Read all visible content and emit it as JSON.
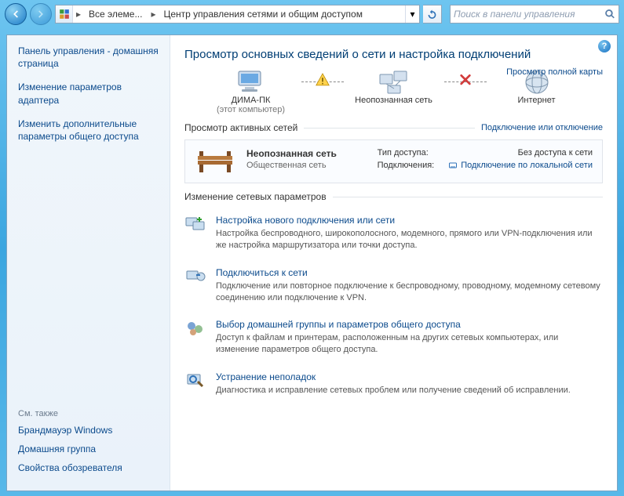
{
  "nav": {
    "crumb1": "Все элеме...",
    "crumb2": "Центр управления сетями и общим доступом",
    "search_placeholder": "Поиск в панели управления"
  },
  "sidebar": {
    "home": "Панель управления - домашняя страница",
    "items": [
      "Изменение параметров адаптера",
      "Изменить дополнительные параметры общего доступа"
    ],
    "see_also_label": "См. также",
    "see_also": [
      "Брандмауэр Windows",
      "Домашняя группа",
      "Свойства обозревателя"
    ]
  },
  "page": {
    "title": "Просмотр основных сведений о сети и настройка подключений",
    "maplink": "Просмотр полной карты",
    "map": {
      "node1_name": "ДИМА-ПК",
      "node1_sub": "(этот компьютер)",
      "node2_name": "Неопознанная сеть",
      "node3_name": "Интернет"
    },
    "active_label": "Просмотр активных сетей",
    "active_link": "Подключение или отключение",
    "activenet": {
      "name": "Неопознанная сеть",
      "type": "Общественная сеть",
      "access_k": "Тип доступа:",
      "access_v": "Без доступа к сети",
      "conn_k": "Подключения:",
      "conn_v": "Подключение по локальной сети"
    },
    "change_label": "Изменение сетевых параметров",
    "settings": [
      {
        "title": "Настройка нового подключения или сети",
        "desc": "Настройка беспроводного, широкополосного, модемного, прямого или VPN-подключения или же настройка маршрутизатора или точки доступа."
      },
      {
        "title": "Подключиться к сети",
        "desc": "Подключение или повторное подключение к беспроводному, проводному, модемному сетевому соединению или подключение к VPN."
      },
      {
        "title": "Выбор домашней группы и параметров общего доступа",
        "desc": "Доступ к файлам и принтерам, расположенным на других сетевых компьютерах, или изменение параметров общего доступа."
      },
      {
        "title": "Устранение неполадок",
        "desc": "Диагностика и исправление сетевых проблем или получение сведений об исправлении."
      }
    ]
  }
}
